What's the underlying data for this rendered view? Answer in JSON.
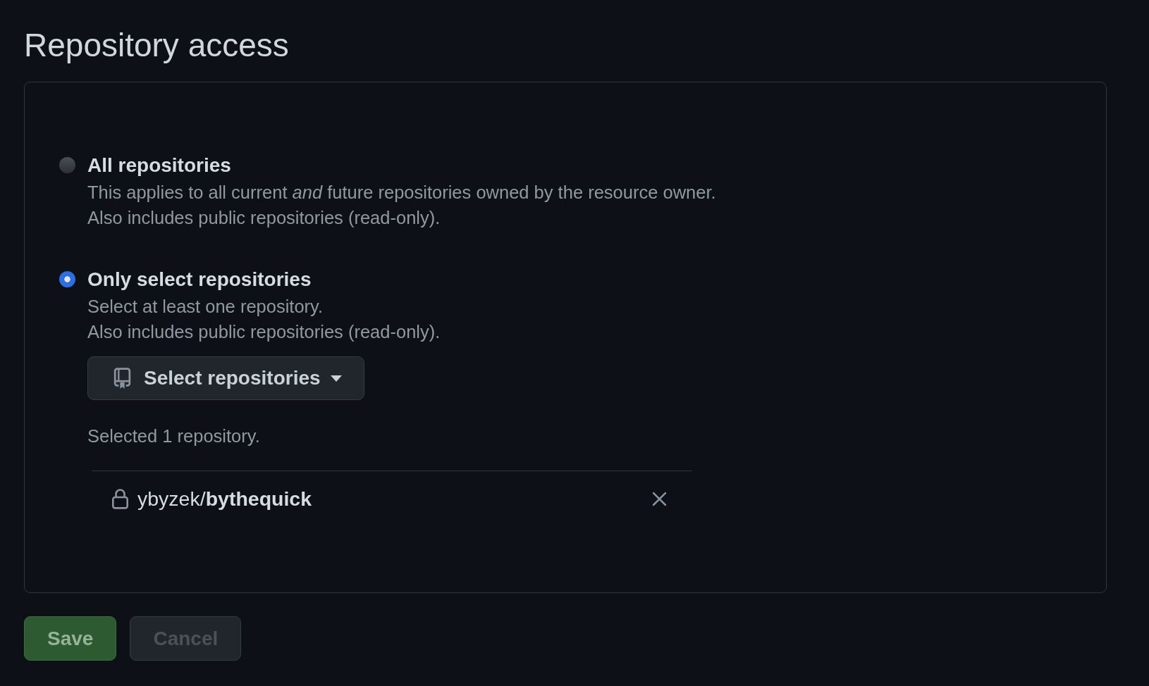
{
  "title": "Repository access",
  "options": [
    {
      "label": "All repositories",
      "selected": false,
      "description_lines": [
        "This applies to all current *and* future repositories owned by the resource owner.",
        "Also includes public repositories (read-only)."
      ]
    },
    {
      "label": "Only select repositories",
      "selected": true,
      "description_lines": [
        "Select at least one repository.",
        "Also includes public repositories (read-only)."
      ],
      "select_button": {
        "label": "Select repositories"
      },
      "selection_summary": "Selected 1 repository.",
      "selected_repositories": [
        {
          "name": "ybyzek/**bythequick**",
          "private": true
        }
      ]
    }
  ],
  "buttons": [
    {
      "label": "Save",
      "kind": "primary",
      "disabled": true
    },
    {
      "label": "Cancel",
      "kind": "secondary",
      "disabled": true
    }
  ]
}
